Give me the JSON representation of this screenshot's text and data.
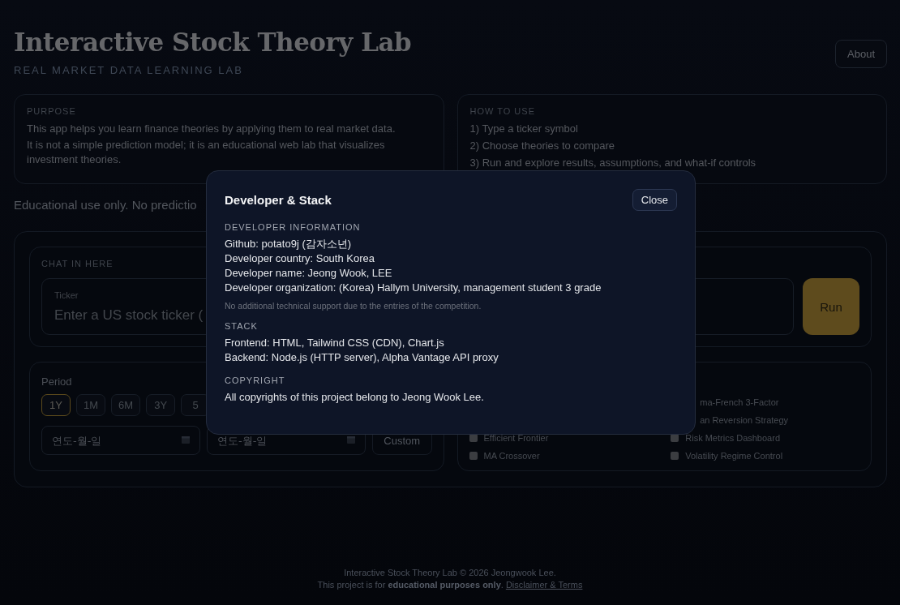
{
  "header": {
    "title": "Interactive Stock Theory Lab",
    "subtitle": "REAL MARKET DATA LEARNING LAB",
    "about_button": "About"
  },
  "info_cards": [
    {
      "heading": "PURPOSE",
      "lines": [
        "This app helps you learn finance theories by applying them to real market data.",
        "It is not a simple prediction model; it is an educational web lab that visualizes investment theories."
      ]
    },
    {
      "heading": "HOW TO USE",
      "lines": [
        "1) Type a ticker symbol",
        "2) Choose theories to compare",
        "3) Run and explore results, assumptions, and what-if controls"
      ]
    }
  ],
  "disclaimer": "Educational use only. No predictio",
  "chat": {
    "heading": "CHAT IN HERE",
    "ticker_label": "Ticker",
    "ticker_placeholder": "Enter a US stock ticker (",
    "run_button": "Run"
  },
  "period": {
    "label": "Period",
    "buttons": [
      {
        "label": "1Y",
        "selected": true
      },
      {
        "label": "1M",
        "selected": false
      },
      {
        "label": "6M",
        "selected": false
      },
      {
        "label": "3Y",
        "selected": false
      },
      {
        "label": "5",
        "selected": false
      }
    ],
    "start_placeholder": "연도-월-일",
    "end_placeholder": "연도-월-일",
    "custom_button": "Custom"
  },
  "theories": {
    "left": [
      {
        "label": "Efficient Frontier",
        "checked": false
      },
      {
        "label": "MA Crossover",
        "checked": false
      }
    ],
    "right": [
      {
        "kind": "partial",
        "label": "ma-French 3-Factor"
      },
      {
        "kind": "partial",
        "label": "an Reversion Strategy"
      },
      {
        "kind": "checkbox",
        "label": "Risk Metrics Dashboard",
        "checked": false
      },
      {
        "kind": "checkbox",
        "label": "Volatility Regime Control",
        "checked": false
      }
    ]
  },
  "modal": {
    "title": "Developer & Stack",
    "close_button": "Close",
    "sections": [
      {
        "heading": "DEVELOPER INFORMATION",
        "lines": [
          "Github: potato9j (감자소년)",
          "Developer country: South Korea",
          "Developer name: Jeong Wook, LEE",
          "Developer organization: (Korea) Hallym University, management student 3 grade"
        ],
        "note": "No additional technical support due to the entries of the competition."
      },
      {
        "heading": "STACK",
        "lines": [
          "Frontend: HTML, Tailwind CSS (CDN), Chart.js",
          "Backend: Node.js (HTTP server), Alpha Vantage API proxy"
        ]
      },
      {
        "heading": "COPYRIGHT",
        "lines": [
          "All copyrights of this project belong to Jeong Wook Lee."
        ]
      }
    ]
  },
  "footer": {
    "line": "Interactive Stock Theory Lab © 2026 Jeongwook Lee.",
    "note": "This project is for **educational purposes only**.",
    "link": "Disclaimer & Terms"
  }
}
